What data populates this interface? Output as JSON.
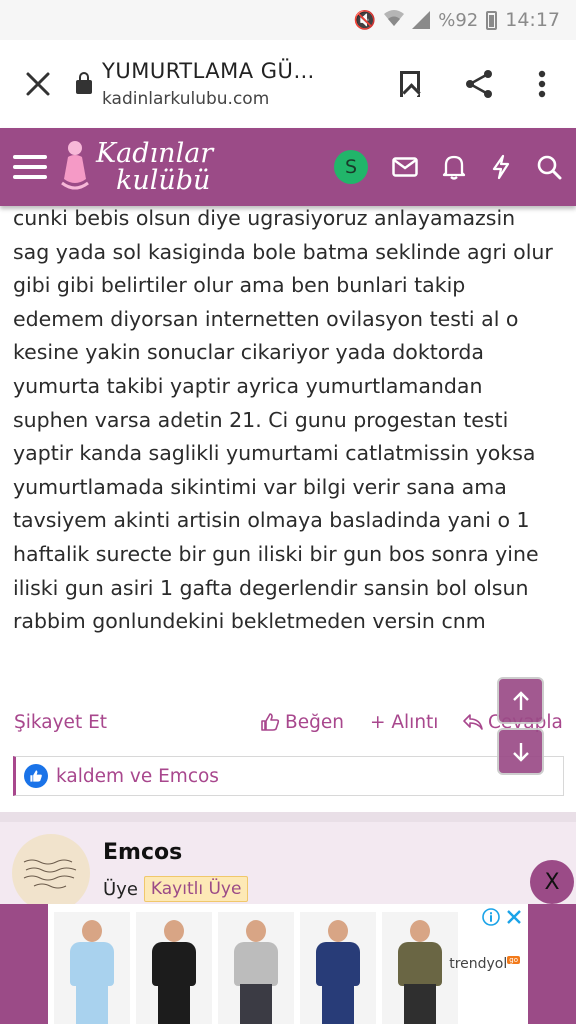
{
  "status_bar": {
    "battery": "%92",
    "time": "14:17"
  },
  "browser": {
    "title": "YUMURTLAMA GÜ…",
    "url": "kadinlarkulubu.com"
  },
  "site": {
    "logo_line1": "Kadınlar",
    "logo_line2": "kulübü",
    "avatar_letter": "S"
  },
  "post": {
    "lines": [
      "cunki bebis olsun diye ugrasiyoruz anlayamazsin",
      "sag yada sol kasiginda bole batma seklinde agri olur",
      "gibi gibi belirtiler olur ama ben bunlari takip",
      "edemem diyorsan internetten ovilasyon testi al o",
      "kesine yakin sonuclar cikariyor yada doktorda",
      "yumurta takibi yaptir ayrica yumurtlamandan",
      "suphen varsa adetin 21. Ci gunu progestan testi",
      "yaptir kanda saglikli yumurtami catlatmissin yoksa",
      "yumurtlamada sikintimi var bilgi verir sana ama",
      "tavsiyem akinti artisin olmaya basladinda yani o 1",
      "haftalik surecte bir gun iliski bir gun bos sonra yine",
      "iliski gun asiri 1 gafta degerlendir sansin bol olsun",
      "rabbim gonlundekini bekletmeden versin cnm"
    ],
    "actions": {
      "report": "Şikayet Et",
      "like": "Beğen",
      "quote": "+ Alıntı",
      "reply": "Cevapla"
    },
    "reactions_text": "kaldem ve Emcos"
  },
  "user": {
    "name": "Emcos",
    "role": "Üye",
    "badge": "Kayıtlı Üye"
  },
  "ad": {
    "close_label": "X",
    "brand": "trendyol",
    "brand_tag": "go"
  },
  "colors": {
    "brand": "#9b4b87",
    "link": "#a8478d",
    "avatar_green": "#21b56a"
  }
}
